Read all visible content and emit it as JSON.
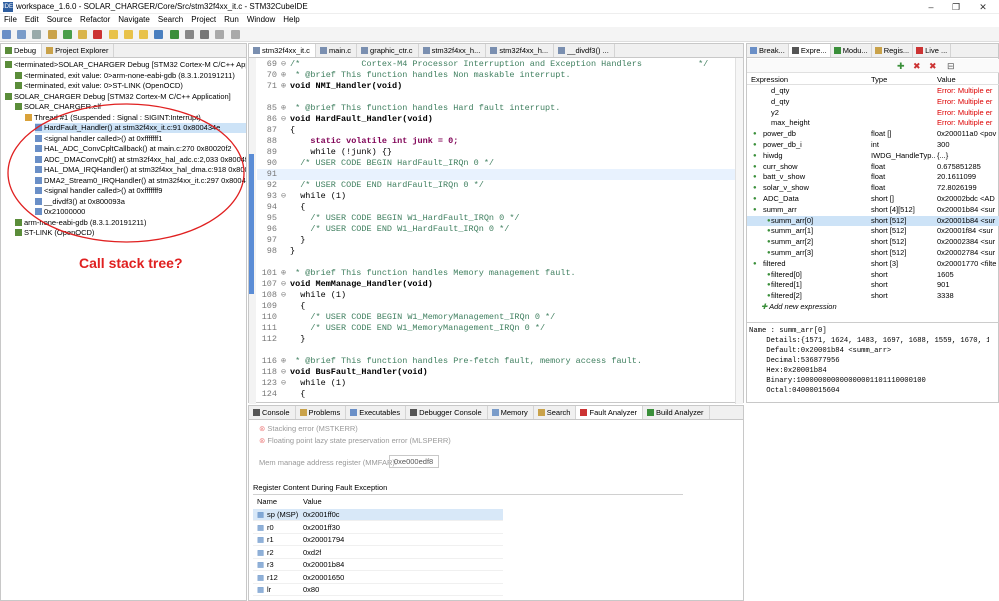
{
  "window": {
    "title": "workspace_1.6.0 - SOLAR_CHARGER/Core/Src/stm32f4xx_it.c - STM32CubeIDE",
    "app_icon": "IDE"
  },
  "menu": [
    "File",
    "Edit",
    "Source",
    "Refactor",
    "Navigate",
    "Search",
    "Project",
    "Run",
    "Window",
    "Help"
  ],
  "left": {
    "tabs": [
      "Debug",
      "Project Explorer"
    ],
    "tree": [
      {
        "indent": 0,
        "text": "<terminated>SOLAR_CHARGER Debug [STM32 Cortex-M C/C++ App"
      },
      {
        "indent": 1,
        "text": "<terminated, exit value: 0>arm-none-eabi-gdb (8.3.1.20191211)"
      },
      {
        "indent": 1,
        "text": "<terminated, exit value: 0>ST-LINK (OpenOCD)"
      },
      {
        "indent": 0,
        "text": "SOLAR_CHARGER Debug [STM32 Cortex-M C/C++ Application]"
      },
      {
        "indent": 1,
        "text": "SOLAR_CHARGER.elf"
      },
      {
        "indent": 2,
        "text": "Thread #1 (Suspended : Signal : SIGINT:Interrupt)"
      },
      {
        "indent": 3,
        "text": "HardFault_Handler() at stm32f4xx_it.c:91 0x800434e",
        "selected": true
      },
      {
        "indent": 3,
        "text": "<signal handler called>() at 0xfffffff1"
      },
      {
        "indent": 3,
        "text": "HAL_ADC_ConvCpltCallback() at main.c:270 0x80020f2"
      },
      {
        "indent": 3,
        "text": "ADC_DMAConvCplt() at stm32f4xx_hal_adc.c:2,033 0x8004f2"
      },
      {
        "indent": 3,
        "text": "HAL_DMA_IRQHandler() at stm32f4xx_hal_dma.c:918 0x8005"
      },
      {
        "indent": 3,
        "text": "DMA2_Stream0_IRQHandler() at stm32f4xx_it.c:297 0x80044c"
      },
      {
        "indent": 3,
        "text": "<signal handler called>() at 0xfffffff9"
      },
      {
        "indent": 3,
        "text": "__divdf3() at 0x800093a"
      },
      {
        "indent": 3,
        "text": "0x21000000"
      },
      {
        "indent": 1,
        "text": "arm-none-eabi-gdb (8.3.1.20191211)"
      },
      {
        "indent": 1,
        "text": "ST-LINK (OpenOCD)"
      }
    ],
    "annotation": "Call stack tree?"
  },
  "editor": {
    "tabs": [
      "stm32f4xx_it.c",
      "main.c",
      "graphic_ctr.c",
      "stm32f4xx_h...",
      "stm32f4xx_h...",
      "__divdf3() ..."
    ],
    "lines": [
      {
        "n": "69",
        "fold": "⊖",
        "text": "/*            Cortex-M4 Processor Interruption and Exception Handlers           */",
        "cls": "cm"
      },
      {
        "n": "70",
        "fold": "⊕",
        "text": " * @brief This function handles Non maskable interrupt.",
        "cls": "cm"
      },
      {
        "n": "71",
        "fold": "⊕",
        "text": "void NMI_Handler(void)",
        "cls": "fn"
      },
      {
        "n": "",
        "fold": "",
        "text": ""
      },
      {
        "n": "85",
        "fold": "⊕",
        "text": " * @brief This function handles Hard fault interrupt.",
        "cls": "cm"
      },
      {
        "n": "86",
        "fold": "⊖",
        "text": "void HardFault_Handler(void)",
        "cls": "fn"
      },
      {
        "n": "87",
        "fold": "",
        "text": "{"
      },
      {
        "n": "88",
        "fold": "",
        "text": "    static volatile int junk = 0;",
        "cls": "kw"
      },
      {
        "n": "89",
        "fold": "",
        "text": "    while (!junk) {}"
      },
      {
        "n": "90",
        "fold": "",
        "text": "  /* USER CODE BEGIN HardFault_IRQn 0 */",
        "cls": "cm"
      },
      {
        "n": "91",
        "fold": "",
        "text": "",
        "hl": true
      },
      {
        "n": "92",
        "fold": "",
        "text": "  /* USER CODE END HardFault_IRQn 0 */",
        "cls": "cm"
      },
      {
        "n": "93",
        "fold": "⊖",
        "text": "  while (1)"
      },
      {
        "n": "94",
        "fold": "",
        "text": "  {"
      },
      {
        "n": "95",
        "fold": "",
        "text": "    /* USER CODE BEGIN W1_HardFault_IRQn 0 */",
        "cls": "cm"
      },
      {
        "n": "96",
        "fold": "",
        "text": "    /* USER CODE END W1_HardFault_IRQn 0 */",
        "cls": "cm"
      },
      {
        "n": "97",
        "fold": "",
        "text": "  }"
      },
      {
        "n": "98",
        "fold": "",
        "text": "}"
      },
      {
        "n": "",
        "fold": "",
        "text": ""
      },
      {
        "n": "101",
        "fold": "⊕",
        "text": " * @brief This function handles Memory management fault.",
        "cls": "cm"
      },
      {
        "n": "107",
        "fold": "⊖",
        "text": "void MemManage_Handler(void)",
        "cls": "fn"
      },
      {
        "n": "108",
        "fold": "⊖",
        "text": "  while (1)"
      },
      {
        "n": "109",
        "fold": "",
        "text": "  {"
      },
      {
        "n": "110",
        "fold": "",
        "text": "    /* USER CODE BEGIN W1_MemoryManagement_IRQn 0 */",
        "cls": "cm"
      },
      {
        "n": "111",
        "fold": "",
        "text": "    /* USER CODE END W1_MemoryManagement_IRQn 0 */",
        "cls": "cm"
      },
      {
        "n": "112",
        "fold": "",
        "text": "  }"
      },
      {
        "n": "",
        "fold": "",
        "text": ""
      },
      {
        "n": "116",
        "fold": "⊕",
        "text": " * @brief This function handles Pre-fetch fault, memory access fault.",
        "cls": "cm"
      },
      {
        "n": "118",
        "fold": "⊖",
        "text": "void BusFault_Handler(void)",
        "cls": "fn"
      },
      {
        "n": "123",
        "fold": "⊖",
        "text": "  while (1)"
      },
      {
        "n": "124",
        "fold": "",
        "text": "  {"
      }
    ]
  },
  "bottom": {
    "tabs": [
      "Console",
      "Problems",
      "Executables",
      "Debugger Console",
      "Memory",
      "Search",
      "Fault Analyzer",
      "Build Analyzer"
    ],
    "faults": [
      "Stacking error (MSTKERR)",
      "Floating point lazy state preservation error (MLSPERR)"
    ],
    "mmfar_label": "Mem manage address register (MMFAR):",
    "mmfar_value": "0xe000edf8",
    "reg_section": "Register Content During Fault Exception",
    "reg_headers": [
      "Name",
      "Value"
    ],
    "registers": [
      [
        "sp (MSP)",
        "0x2001ff0c"
      ],
      [
        "r0",
        "0x2001ff30"
      ],
      [
        "r1",
        "0x20001794"
      ],
      [
        "r2",
        "0xd2f"
      ],
      [
        "r3",
        "0x20001b84"
      ],
      [
        "r12",
        "0x20001650"
      ],
      [
        "lr",
        "0x80"
      ]
    ]
  },
  "right": {
    "tabs": [
      "Break...",
      "Expre...",
      "Modu...",
      "Regis...",
      "Live ..."
    ],
    "headers": [
      "Expression",
      "Type",
      "Value"
    ],
    "rows": [
      {
        "indent": 1,
        "expr": "d_qty",
        "type": "",
        "value": "Error: Multiple er",
        "err": true
      },
      {
        "indent": 1,
        "expr": "d_qty",
        "type": "",
        "value": "Error: Multiple er",
        "err": true
      },
      {
        "indent": 1,
        "expr": "y2",
        "type": "",
        "value": "Error: Multiple er",
        "err": true
      },
      {
        "indent": 1,
        "expr": "max_height",
        "type": "",
        "value": "Error: Multiple er",
        "err": true
      },
      {
        "indent": 0,
        "expr": "power_db",
        "type": "float []",
        "value": "0x200011a0 <pov"
      },
      {
        "indent": 0,
        "expr": "power_db_i",
        "type": "int",
        "value": "300"
      },
      {
        "indent": 0,
        "expr": "hiwdg",
        "type": "IWDG_HandleTyp...",
        "value": "{...}"
      },
      {
        "indent": 0,
        "expr": "curr_show",
        "type": "float",
        "value": "0.675851285"
      },
      {
        "indent": 0,
        "expr": "batt_v_show",
        "type": "float",
        "value": "20.1611099"
      },
      {
        "indent": 0,
        "expr": "solar_v_show",
        "type": "float",
        "value": "72.8026199"
      },
      {
        "indent": 0,
        "expr": "ADC_Data",
        "type": "short []",
        "value": "0x20002bdc <AD"
      },
      {
        "indent": 0,
        "expr": "summ_arr",
        "type": "short [4][512]",
        "value": "0x20001b84 <sur"
      },
      {
        "indent": 1,
        "expr": "summ_arr[0]",
        "type": "short [512]",
        "value": "0x20001b84 <sur",
        "selected": true
      },
      {
        "indent": 1,
        "expr": "summ_arr[1]",
        "type": "short [512]",
        "value": "0x20001f84 <sur"
      },
      {
        "indent": 1,
        "expr": "summ_arr[2]",
        "type": "short [512]",
        "value": "0x20002384 <sur"
      },
      {
        "indent": 1,
        "expr": "summ_arr[3]",
        "type": "short [512]",
        "value": "0x20002784 <sur"
      },
      {
        "indent": 0,
        "expr": "filtered",
        "type": "short [3]",
        "value": "0x20001770 <filte"
      },
      {
        "indent": 1,
        "expr": "filtered[0]",
        "type": "short",
        "value": "1605"
      },
      {
        "indent": 1,
        "expr": "filtered[1]",
        "type": "short",
        "value": "901"
      },
      {
        "indent": 1,
        "expr": "filtered[2]",
        "type": "short",
        "value": "3338"
      }
    ],
    "add_expr": "Add new expression",
    "details": [
      "Name : summ_arr[0]",
      "    Details:{1571, 1624, 1483, 1697, 1688, 1559, 1670, 155",
      "    Default:0x20001b84 <summ_arr>",
      "    Decimal:536877956",
      "    Hex:0x20001b84",
      "    Binary:100000000000000001101110000100",
      "    Octal:04000015604"
    ]
  },
  "colors": {
    "accent": "#d4e5f7",
    "annotation": "#e02020",
    "highlight_line": "#e8f2fe"
  }
}
